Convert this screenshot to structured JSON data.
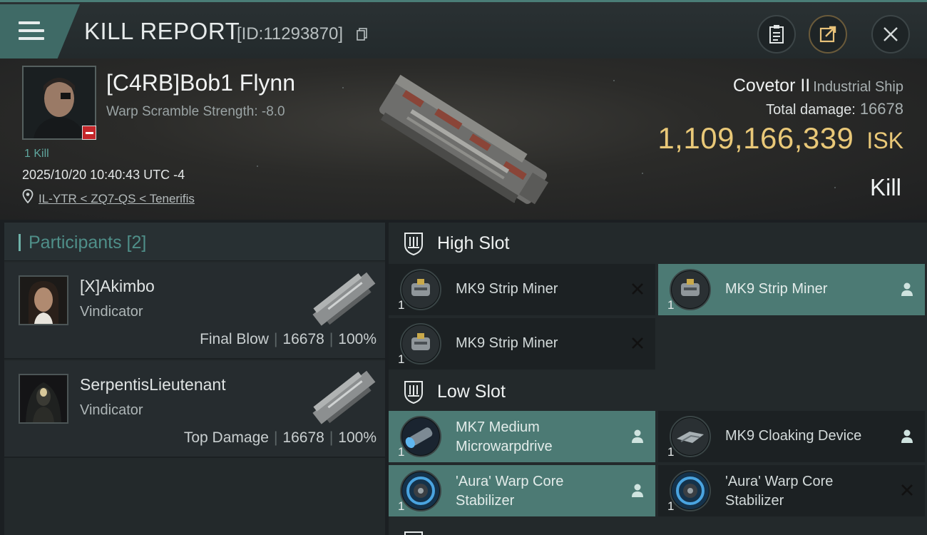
{
  "header": {
    "title": "KILL REPORT",
    "kill_id": "[ID:11293870]"
  },
  "victim": {
    "name": "[C4RB]Bob1 Flynn",
    "warp_scramble": "Warp Scramble Strength: -8.0",
    "kills": "1 Kill",
    "timestamp": "2025/10/20 10:40:43 UTC -4",
    "location": "IL-YTR < ZQ7-QS < Tenerifis",
    "ship_name": "Covetor II",
    "ship_class": "Industrial Ship",
    "damage_label": "Total damage:",
    "damage_value": "16678",
    "isk_value": "1,109,166,339",
    "isk_unit": "ISK",
    "report_type": "Kill"
  },
  "participants": {
    "title": "Participants [2]",
    "items": [
      {
        "name": "[X]Akimbo",
        "ship": "Vindicator",
        "role": "Final Blow",
        "damage": "16678",
        "percent": "100%"
      },
      {
        "name": "SerpentisLieutenant",
        "ship": "Vindicator",
        "role": "Top Damage",
        "damage": "16678",
        "percent": "100%"
      }
    ]
  },
  "fitting": {
    "high_slot": {
      "title": "High Slot",
      "modules": [
        {
          "name": "MK9 Strip Miner",
          "qty": "1",
          "status": "destroyed",
          "icon": "strip-miner-icon"
        },
        {
          "name": "MK9 Strip Miner",
          "qty": "1",
          "status": "dropped",
          "icon": "strip-miner-icon"
        },
        {
          "name": "MK9 Strip Miner",
          "qty": "1",
          "status": "destroyed",
          "icon": "strip-miner-icon"
        }
      ]
    },
    "low_slot": {
      "title": "Low Slot",
      "modules": [
        {
          "name_line1": "MK7 Medium",
          "name_line2": "Microwarpdrive",
          "qty": "1",
          "status": "dropped",
          "icon": "microwarpdrive-icon"
        },
        {
          "name_line1": "MK9 Cloaking Device",
          "name_line2": "",
          "qty": "1",
          "status": "dropped",
          "icon": "cloaking-device-icon"
        },
        {
          "name_line1": "'Aura' Warp Core",
          "name_line2": "Stabilizer",
          "qty": "1",
          "status": "dropped",
          "icon": "warp-core-stabilizer-icon"
        },
        {
          "name_line1": "'Aura' Warp Core",
          "name_line2": "Stabilizer",
          "qty": "1",
          "status": "destroyed",
          "icon": "warp-core-stabilizer-icon"
        }
      ]
    }
  },
  "colors": {
    "accent_teal": "#4c7a74",
    "isk_gold": "#e9c878",
    "loss_red": "#c4262a"
  }
}
